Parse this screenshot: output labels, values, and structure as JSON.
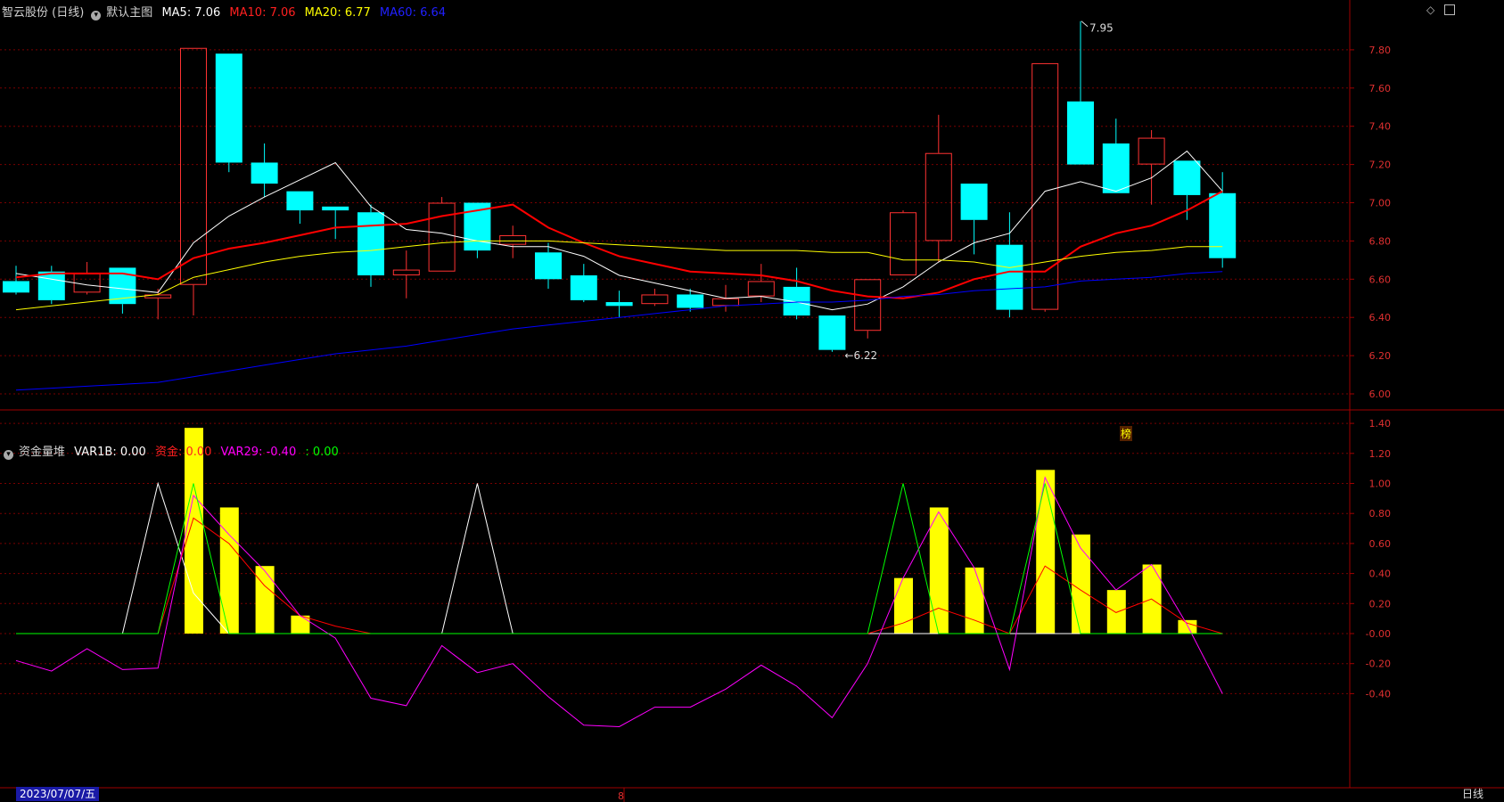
{
  "main_header": {
    "stock_name": "智云股份 (日线)",
    "indicator_name": "默认主图",
    "ma5": "MA5: 7.06",
    "ma10": "MA10: 7.06",
    "ma20": "MA20: 6.77",
    "ma60": "MA60: 6.64"
  },
  "sub_header": {
    "indicator_name": "资金量堆",
    "var1b": "VAR1B: 0.00",
    "zijin": "资金: 0.00",
    "var29": "VAR29: -0.40",
    "green": ": 0.00"
  },
  "footer": {
    "date": "2023/07/07/五",
    "period": "日线",
    "marker": "8"
  },
  "badge": "榜",
  "colors": {
    "up": "#ff3232",
    "down": "#00ffff",
    "ma5": "#ffffff",
    "ma10": "#ff0000",
    "ma20": "#ffff00",
    "ma60": "#0000ff",
    "bars": "#ffff00",
    "zijin": "#ff0000",
    "var29": "#ff00ff",
    "var1b": "#ffffff",
    "green": "#00ff00",
    "grid": "#7a0000"
  },
  "chart_data": [
    {
      "type": "candlestick",
      "ylim": [
        5.95,
        8.05
      ],
      "yticks": [
        "6.00",
        "6.20",
        "6.40",
        "6.60",
        "6.80",
        "7.00",
        "7.20",
        "7.40",
        "7.60",
        "7.80"
      ],
      "max_label": "7.95",
      "min_label": "6.22",
      "candles": [
        {
          "o": 6.59,
          "c": 6.53,
          "h": 6.67,
          "l": 6.52
        },
        {
          "o": 6.64,
          "c": 6.49,
          "h": 6.67,
          "l": 6.47
        },
        {
          "o": 6.53,
          "c": 6.63,
          "h": 6.69,
          "l": 6.52
        },
        {
          "o": 6.66,
          "c": 6.47,
          "h": 6.66,
          "l": 6.42
        },
        {
          "o": 6.5,
          "c": 6.52,
          "h": 6.55,
          "l": 6.39
        },
        {
          "o": 6.57,
          "c": 7.81,
          "h": 7.81,
          "l": 6.41
        },
        {
          "o": 7.78,
          "c": 7.21,
          "h": 7.78,
          "l": 7.16
        },
        {
          "o": 7.21,
          "c": 7.1,
          "h": 7.31,
          "l": 7.03
        },
        {
          "o": 7.06,
          "c": 6.96,
          "h": 7.06,
          "l": 6.89
        },
        {
          "o": 6.98,
          "c": 6.96,
          "h": 6.98,
          "l": 6.81
        },
        {
          "o": 6.95,
          "c": 6.62,
          "h": 6.99,
          "l": 6.56
        },
        {
          "o": 6.62,
          "c": 6.65,
          "h": 6.75,
          "l": 6.5
        },
        {
          "o": 6.64,
          "c": 7.0,
          "h": 7.03,
          "l": 6.64
        },
        {
          "o": 7.0,
          "c": 6.75,
          "h": 7.0,
          "l": 6.71
        },
        {
          "o": 6.78,
          "c": 6.83,
          "h": 6.88,
          "l": 6.71
        },
        {
          "o": 6.74,
          "c": 6.6,
          "h": 6.79,
          "l": 6.55
        },
        {
          "o": 6.62,
          "c": 6.49,
          "h": 6.68,
          "l": 6.48
        },
        {
          "o": 6.48,
          "c": 6.46,
          "h": 6.54,
          "l": 6.4
        },
        {
          "o": 6.47,
          "c": 6.52,
          "h": 6.55,
          "l": 6.46
        },
        {
          "o": 6.52,
          "c": 6.45,
          "h": 6.55,
          "l": 6.43
        },
        {
          "o": 6.46,
          "c": 6.5,
          "h": 6.57,
          "l": 6.43
        },
        {
          "o": 6.51,
          "c": 6.59,
          "h": 6.68,
          "l": 6.48
        },
        {
          "o": 6.56,
          "c": 6.41,
          "h": 6.66,
          "l": 6.39
        },
        {
          "o": 6.41,
          "c": 6.23,
          "h": 6.41,
          "l": 6.22
        },
        {
          "o": 6.33,
          "c": 6.6,
          "h": 6.6,
          "l": 6.29
        },
        {
          "o": 6.62,
          "c": 6.95,
          "h": 6.96,
          "l": 6.62
        },
        {
          "o": 6.8,
          "c": 7.26,
          "h": 7.46,
          "l": 6.69
        },
        {
          "o": 7.1,
          "c": 6.91,
          "h": 7.1,
          "l": 6.73
        },
        {
          "o": 6.78,
          "c": 6.44,
          "h": 6.95,
          "l": 6.4
        },
        {
          "o": 6.44,
          "c": 7.73,
          "h": 7.73,
          "l": 6.43
        },
        {
          "o": 7.53,
          "c": 7.2,
          "h": 7.95,
          "l": 7.2
        },
        {
          "o": 7.31,
          "c": 7.05,
          "h": 7.44,
          "l": 7.05
        },
        {
          "o": 7.2,
          "c": 7.34,
          "h": 7.38,
          "l": 6.99
        },
        {
          "o": 7.22,
          "c": 7.04,
          "h": 7.22,
          "l": 6.91
        },
        {
          "o": 7.05,
          "c": 6.71,
          "h": 7.16,
          "l": 6.66
        }
      ],
      "series": [
        {
          "name": "MA5",
          "values": [
            6.63,
            6.6,
            6.57,
            6.55,
            6.53,
            6.79,
            6.93,
            7.03,
            7.12,
            7.21,
            6.98,
            6.86,
            6.84,
            6.8,
            6.77,
            6.77,
            6.72,
            6.62,
            6.58,
            6.54,
            6.5,
            6.51,
            6.48,
            6.44,
            6.47,
            6.56,
            6.69,
            6.79,
            6.84,
            7.06,
            7.11,
            7.06,
            7.13,
            7.27,
            7.06
          ]
        },
        {
          "name": "MA10",
          "values": [
            6.61,
            6.63,
            6.63,
            6.63,
            6.6,
            6.71,
            6.76,
            6.79,
            6.83,
            6.87,
            6.88,
            6.89,
            6.93,
            6.96,
            6.99,
            6.87,
            6.79,
            6.72,
            6.68,
            6.64,
            6.63,
            6.62,
            6.59,
            6.54,
            6.51,
            6.5,
            6.53,
            6.6,
            6.64,
            6.64,
            6.77,
            6.84,
            6.88,
            6.96,
            7.06
          ]
        },
        {
          "name": "MA20",
          "values": [
            6.44,
            6.46,
            6.48,
            6.5,
            6.52,
            6.61,
            6.65,
            6.69,
            6.72,
            6.74,
            6.75,
            6.77,
            6.79,
            6.8,
            6.8,
            6.8,
            6.79,
            6.78,
            6.77,
            6.76,
            6.75,
            6.75,
            6.75,
            6.74,
            6.74,
            6.7,
            6.7,
            6.69,
            6.66,
            6.69,
            6.72,
            6.74,
            6.75,
            6.77,
            6.77
          ]
        },
        {
          "name": "MA60",
          "values": [
            6.02,
            6.03,
            6.04,
            6.05,
            6.06,
            6.09,
            6.12,
            6.15,
            6.18,
            6.21,
            6.23,
            6.25,
            6.28,
            6.31,
            6.34,
            6.36,
            6.38,
            6.4,
            6.42,
            6.44,
            6.46,
            6.47,
            6.48,
            6.48,
            6.49,
            6.51,
            6.52,
            6.54,
            6.55,
            6.56,
            6.59,
            6.6,
            6.61,
            6.63,
            6.64
          ]
        }
      ]
    },
    {
      "type": "bar",
      "ylim": [
        -0.5,
        1.5
      ],
      "yticks": [
        "-0.40",
        "-0.20",
        "-0.00",
        "0.20",
        "0.40",
        "0.60",
        "0.80",
        "1.00",
        "1.20",
        "1.40"
      ],
      "bars": [
        0,
        0,
        0,
        0,
        0,
        1.37,
        0.84,
        0.45,
        0.12,
        0,
        0,
        0,
        0,
        0,
        0,
        0,
        0,
        0,
        0,
        0,
        0,
        0,
        0,
        0,
        0,
        0.37,
        0.84,
        0.44,
        0,
        1.09,
        0.66,
        0.29,
        0.46,
        0.09,
        0
      ],
      "series": [
        {
          "name": "VAR1B",
          "values": [
            0,
            0,
            0,
            0,
            1.0,
            0.27,
            0,
            0,
            0,
            0,
            0,
            0,
            0,
            1.0,
            0,
            0,
            0,
            0,
            0,
            0,
            0,
            0,
            0,
            0,
            0,
            0,
            0,
            0,
            0,
            0,
            0,
            0,
            0,
            0,
            0
          ]
        },
        {
          "name": "资金",
          "values": [
            0,
            0,
            0,
            0,
            0,
            0.77,
            0.6,
            0.32,
            0.12,
            0.05,
            0,
            0,
            0,
            0,
            0,
            0,
            0,
            0,
            0,
            0,
            0,
            0,
            0,
            0,
            0,
            0.07,
            0.17,
            0.09,
            0,
            0.45,
            0.29,
            0.14,
            0.23,
            0.07,
            0
          ]
        },
        {
          "name": "VAR29",
          "values": [
            -0.18,
            -0.25,
            -0.1,
            -0.24,
            -0.23,
            0.92,
            0.66,
            0.42,
            0.12,
            -0.03,
            -0.43,
            -0.48,
            -0.08,
            -0.26,
            -0.2,
            -0.42,
            -0.61,
            -0.62,
            -0.49,
            -0.49,
            -0.37,
            -0.21,
            -0.35,
            -0.56,
            -0.2,
            0.37,
            0.81,
            0.44,
            -0.24,
            1.04,
            0.57,
            0.29,
            0.46,
            0.06,
            -0.4
          ]
        },
        {
          "name": "green",
          "values": [
            0,
            0,
            0,
            0,
            0,
            1.0,
            0,
            0,
            0,
            0,
            0,
            0,
            0,
            0,
            0,
            0,
            0,
            0,
            0,
            0,
            0,
            0,
            0,
            0,
            0,
            1.0,
            0,
            0,
            0,
            1.0,
            0,
            0,
            0,
            0,
            0
          ]
        }
      ]
    }
  ]
}
